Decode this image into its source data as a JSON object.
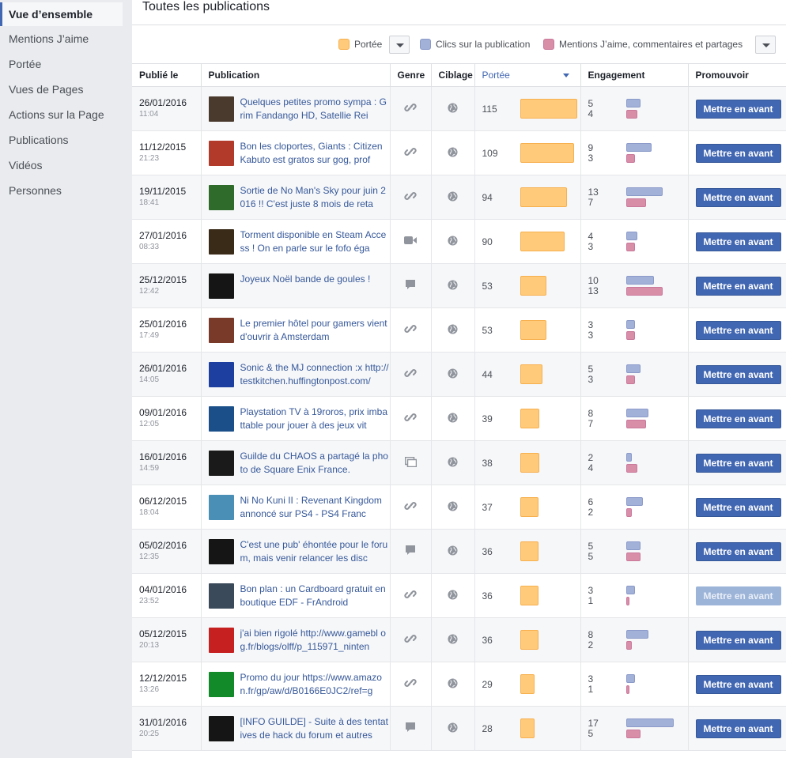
{
  "sidebar": {
    "items": [
      {
        "label": "Vue d’ensemble"
      },
      {
        "label": "Mentions J’aime"
      },
      {
        "label": "Portée"
      },
      {
        "label": "Vues de Pages"
      },
      {
        "label": "Actions sur la Page"
      },
      {
        "label": "Publications"
      },
      {
        "label": "Vidéos"
      },
      {
        "label": "Personnes"
      }
    ]
  },
  "section": {
    "title": "Toutes les publications"
  },
  "legend": {
    "reach": "Portée",
    "clicks": "Clics sur la publication",
    "engagement": "Mentions J’aime, commentaires et partages"
  },
  "colors": {
    "reach": "#ffca7a",
    "clicks": "#a1b1d8",
    "likes": "#d98ea7",
    "brand": "#4267b2"
  },
  "table": {
    "headers": {
      "published": "Publié le",
      "post": "Publication",
      "type": "Genre",
      "targeting": "Ciblage",
      "reach": "Portée",
      "engagement": "Engagement",
      "promote": "Promouvoir"
    },
    "promote_label": "Mettre en avant",
    "rows": [
      {
        "date": "26/01/2016",
        "time": "11:04",
        "text": "Quelques petites promo sympa : Grim Fandango HD, Satellie Rei",
        "type": "link-icon",
        "reach": 115,
        "clicks": 5,
        "likes": 4,
        "thumb": "#4a3a2e",
        "promotable": true
      },
      {
        "date": "11/12/2015",
        "time": "21:23",
        "text": "Bon les cloportes, Giants : Citizen Kabuto est gratos sur gog, prof",
        "type": "link-icon",
        "reach": 109,
        "clicks": 9,
        "likes": 3,
        "thumb": "#b23a2a",
        "promotable": true
      },
      {
        "date": "19/11/2015",
        "time": "18:41",
        "text": "Sortie de No Man's Sky pour juin 2016 !! C'est juste 8 mois de reta",
        "type": "link-icon",
        "reach": 94,
        "clicks": 13,
        "likes": 7,
        "thumb": "#2f6b2a",
        "promotable": true
      },
      {
        "date": "27/01/2016",
        "time": "08:33",
        "text": "Torment disponible en Steam Access ! On en parle sur le fofo éga",
        "type": "video-icon",
        "reach": 90,
        "clicks": 4,
        "likes": 3,
        "thumb": "#3a2a18",
        "promotable": true
      },
      {
        "date": "25/12/2015",
        "time": "12:42",
        "text": "Joyeux Noël bande de goules !",
        "type": "status-icon",
        "reach": 53,
        "clicks": 10,
        "likes": 13,
        "thumb": "#151515",
        "promotable": true
      },
      {
        "date": "25/01/2016",
        "time": "17:49",
        "text": "Le premier hôtel pour gamers vient d'ouvrir à Amsterdam",
        "type": "link-icon",
        "reach": 53,
        "clicks": 3,
        "likes": 3,
        "thumb": "#7a3a2a",
        "promotable": true
      },
      {
        "date": "26/01/2016",
        "time": "14:05",
        "text": "Sonic & the MJ connection :x http://testkitchen.huffingtonpost.com/",
        "type": "link-icon",
        "reach": 44,
        "clicks": 5,
        "likes": 3,
        "thumb": "#1c3fa0",
        "promotable": true
      },
      {
        "date": "09/01/2016",
        "time": "12:05",
        "text": "Playstation TV à 19roros, prix imbattable pour jouer à des jeux vit",
        "type": "link-icon",
        "reach": 39,
        "clicks": 8,
        "likes": 7,
        "thumb": "#1a4f8a",
        "promotable": true
      },
      {
        "date": "16/01/2016",
        "time": "14:59",
        "text": "Guilde du CHAOS a partagé la photo de Square Enix France.",
        "type": "photo-icon",
        "reach": 38,
        "clicks": 2,
        "likes": 4,
        "thumb": "#1a1a1a",
        "promotable": true
      },
      {
        "date": "06/12/2015",
        "time": "18:04",
        "text": "Ni No Kuni II : Revenant Kingdom annoncé sur PS4 - PS4 Franc",
        "type": "link-icon",
        "reach": 37,
        "clicks": 6,
        "likes": 2,
        "thumb": "#4a8fb5",
        "promotable": true
      },
      {
        "date": "05/02/2016",
        "time": "12:35",
        "text": "C'est une pub' éhontée pour le forum, mais venir relancer les disc",
        "type": "status-icon",
        "reach": 36,
        "clicks": 5,
        "likes": 5,
        "thumb": "#151515",
        "promotable": true
      },
      {
        "date": "04/01/2016",
        "time": "23:52",
        "text": "Bon plan : un Cardboard gratuit en boutique EDF - FrAndroid",
        "type": "link-icon",
        "reach": 36,
        "clicks": 3,
        "likes": 1,
        "thumb": "#3b4a5a",
        "promotable": false
      },
      {
        "date": "05/12/2015",
        "time": "20:13",
        "text": "j'ai bien rigolé http://www.gamebl og.fr/blogs/olff/p_115971_ninten",
        "type": "link-icon",
        "reach": 36,
        "clicks": 8,
        "likes": 2,
        "thumb": "#c62020",
        "promotable": true
      },
      {
        "date": "12/12/2015",
        "time": "13:26",
        "text": "Promo du jour https://www.amazon.fr/gp/aw/d/B0166E0JC2/ref=g",
        "type": "link-icon",
        "reach": 29,
        "clicks": 3,
        "likes": 1,
        "thumb": "#128a2a",
        "promotable": true
      },
      {
        "date": "31/01/2016",
        "time": "20:25",
        "text": "[INFO GUILDE] - Suite à des tentatives de hack du forum et autres",
        "type": "status-icon",
        "reach": 28,
        "clicks": 17,
        "likes": 5,
        "thumb": "#151515",
        "promotable": true
      }
    ]
  }
}
